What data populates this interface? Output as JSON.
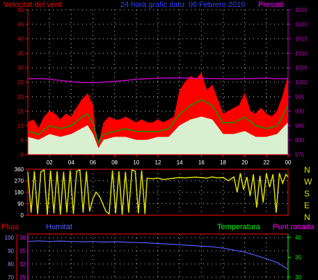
{
  "header": {
    "left": "Velocitat del vent",
    "center": "24 hora grafic datu: 06 Febrero 2019",
    "right": "Pressió"
  },
  "legend": {
    "rain": "Pluja",
    "humidity": "Humitat",
    "temperature": "Temperatura",
    "dewpoint": "Punt rosada"
  },
  "direction_labels": [
    "N",
    "W",
    "S",
    "E",
    "N"
  ],
  "colors": {
    "background": "#000000",
    "axis": "#ff0000",
    "grid": "#ffffff",
    "wind_gust": "#ff0000",
    "wind_avg": "#00a000",
    "wind_speed": "#d8f0d0",
    "pressure": "#c000c0",
    "direction": "#e0e000",
    "humidity": "#5060ff",
    "dewpoint_axis": "#ff00ff",
    "temperature_axis": "#00ff00",
    "rain_axis": "#ff0000"
  },
  "chart_data": [
    {
      "type": "area",
      "name": "wind_pressure",
      "title": "24 hora grafic datu: 06 Febrero 2019",
      "x_ticks": [
        "02",
        "04",
        "06",
        "08",
        "10",
        "12",
        "14",
        "16",
        "18",
        "20",
        "22",
        "00"
      ],
      "y_left_ticks": [
        "0",
        "5",
        "10",
        "15",
        "20",
        "25",
        "30",
        "35",
        "40",
        "45",
        "50"
      ],
      "y_left_label": "Velocitat del vent",
      "ylim_left": [
        0,
        50
      ],
      "y_right_ticks": [
        "975",
        "980",
        "985",
        "990",
        "995",
        "1000",
        "1005",
        "1010",
        "1015",
        "1020",
        "1025"
      ],
      "y_right_label": "Pressió",
      "ylim_right": [
        975,
        1025
      ],
      "x_range_hours": [
        0,
        24
      ],
      "series": [
        {
          "name": "gust",
          "role": "wind_gust",
          "points": [
            [
              0,
              11
            ],
            [
              0.5,
              12
            ],
            [
              1,
              9
            ],
            [
              1.5,
              13
            ],
            [
              2,
              15
            ],
            [
              2.5,
              14
            ],
            [
              3,
              12
            ],
            [
              3.5,
              14
            ],
            [
              4,
              13
            ],
            [
              4.5,
              16
            ],
            [
              5,
              19
            ],
            [
              5.5,
              21
            ],
            [
              6,
              17
            ],
            [
              6.2,
              8
            ],
            [
              6.5,
              3
            ],
            [
              7,
              11
            ],
            [
              7.5,
              13
            ],
            [
              8,
              12
            ],
            [
              8.5,
              12
            ],
            [
              9,
              13
            ],
            [
              9.5,
              12
            ],
            [
              10,
              11
            ],
            [
              10.5,
              12
            ],
            [
              11,
              11
            ],
            [
              11.5,
              11
            ],
            [
              12,
              12
            ],
            [
              12.5,
              11
            ],
            [
              13,
              12
            ],
            [
              13.5,
              13
            ],
            [
              14,
              22
            ],
            [
              14.5,
              25
            ],
            [
              15,
              27
            ],
            [
              15.5,
              26
            ],
            [
              16,
              28
            ],
            [
              16.5,
              22
            ],
            [
              17,
              24
            ],
            [
              17.5,
              19
            ],
            [
              18,
              14
            ],
            [
              18.5,
              15
            ],
            [
              19,
              16
            ],
            [
              19.5,
              17
            ],
            [
              20,
              21
            ],
            [
              20.5,
              15
            ],
            [
              21,
              14
            ],
            [
              21.5,
              16
            ],
            [
              22,
              14
            ],
            [
              22.5,
              13
            ],
            [
              23,
              15
            ],
            [
              23.5,
              20
            ],
            [
              24,
              27
            ]
          ]
        },
        {
          "name": "avg",
          "role": "wind_avg",
          "points": [
            [
              0,
              8
            ],
            [
              1,
              7
            ],
            [
              2,
              10
            ],
            [
              3,
              9
            ],
            [
              4,
              10
            ],
            [
              5,
              13
            ],
            [
              5.5,
              14
            ],
            [
              6,
              11
            ],
            [
              6.5,
              4
            ],
            [
              7,
              7
            ],
            [
              8,
              8
            ],
            [
              9,
              9
            ],
            [
              10,
              8
            ],
            [
              11,
              8
            ],
            [
              12,
              8
            ],
            [
              13,
              9
            ],
            [
              14,
              14
            ],
            [
              15,
              17
            ],
            [
              16,
              19
            ],
            [
              17,
              17
            ],
            [
              18,
              11
            ],
            [
              19,
              11
            ],
            [
              20,
              13
            ],
            [
              21,
              10
            ],
            [
              22,
              9
            ],
            [
              23,
              10
            ],
            [
              24,
              17
            ]
          ]
        },
        {
          "name": "speed",
          "role": "wind_speed",
          "points": [
            [
              0,
              6
            ],
            [
              1,
              5
            ],
            [
              2,
              7
            ],
            [
              3,
              6
            ],
            [
              4,
              7
            ],
            [
              5,
              9
            ],
            [
              5.5,
              10
            ],
            [
              6,
              7
            ],
            [
              6.5,
              2
            ],
            [
              7,
              5
            ],
            [
              8,
              6
            ],
            [
              9,
              6
            ],
            [
              10,
              5
            ],
            [
              11,
              5
            ],
            [
              12,
              6
            ],
            [
              13,
              6
            ],
            [
              14,
              10
            ],
            [
              15,
              12
            ],
            [
              16,
              13
            ],
            [
              17,
              12
            ],
            [
              18,
              7
            ],
            [
              19,
              7
            ],
            [
              20,
              8
            ],
            [
              21,
              6
            ],
            [
              22,
              6
            ],
            [
              23,
              7
            ],
            [
              24,
              11
            ]
          ]
        },
        {
          "name": "pressure",
          "role": "pressure",
          "points": [
            [
              0,
              1001.2
            ],
            [
              1,
              1001.3
            ],
            [
              2,
              1001
            ],
            [
              3,
              1000.6
            ],
            [
              4,
              1000.2
            ],
            [
              5,
              999.9
            ],
            [
              6,
              999.8
            ],
            [
              7,
              1000
            ],
            [
              8,
              1000.3
            ],
            [
              9,
              1000.6
            ],
            [
              10,
              1001
            ],
            [
              11,
              1001.2
            ],
            [
              12,
              1001.4
            ],
            [
              13,
              1001.5
            ],
            [
              14,
              1001.5
            ],
            [
              15,
              1001.4
            ],
            [
              16,
              1001.3
            ],
            [
              17,
              1001.3
            ],
            [
              18,
              1001.2
            ],
            [
              19,
              1001.1
            ],
            [
              20,
              1001.2
            ],
            [
              21,
              1001.3
            ],
            [
              22,
              1001.4
            ],
            [
              23,
              1001.2
            ],
            [
              24,
              1001.2
            ]
          ]
        }
      ]
    },
    {
      "type": "line",
      "name": "wind_direction",
      "y_ticks": [
        "0",
        "90",
        "180",
        "270",
        "360"
      ],
      "ylim": [
        0,
        360
      ],
      "x_range_hours": [
        0,
        24
      ],
      "series": [
        {
          "name": "direction",
          "role": "direction",
          "points": [
            [
              0,
              340
            ],
            [
              0.3,
              20
            ],
            [
              0.6,
              345
            ],
            [
              0.9,
              10
            ],
            [
              1.2,
              340
            ],
            [
              1.5,
              355
            ],
            [
              1.8,
              5
            ],
            [
              2.1,
              350
            ],
            [
              2.4,
              15
            ],
            [
              2.7,
              345
            ],
            [
              3,
              5
            ],
            [
              3.3,
              340
            ],
            [
              3.6,
              20
            ],
            [
              3.9,
              350
            ],
            [
              4.2,
              10
            ],
            [
              4.5,
              345
            ],
            [
              4.8,
              355
            ],
            [
              5.1,
              20
            ],
            [
              5.4,
              345
            ],
            [
              5.7,
              30
            ],
            [
              6,
              130
            ],
            [
              6.3,
              180
            ],
            [
              6.6,
              150
            ],
            [
              6.9,
              90
            ],
            [
              7.2,
              30
            ],
            [
              7.5,
              10
            ],
            [
              7.8,
              350
            ],
            [
              8.1,
              15
            ],
            [
              8.4,
              345
            ],
            [
              8.7,
              5
            ],
            [
              9,
              340
            ],
            [
              9.3,
              20
            ],
            [
              9.6,
              355
            ],
            [
              9.9,
              345
            ],
            [
              10.2,
              15
            ],
            [
              10.5,
              350
            ],
            [
              10.8,
              10
            ],
            [
              11,
              290
            ],
            [
              11.5,
              285
            ],
            [
              12,
              290
            ],
            [
              12.5,
              280
            ],
            [
              13,
              285
            ],
            [
              13.5,
              290
            ],
            [
              14,
              295
            ],
            [
              14.5,
              292
            ],
            [
              15,
              296
            ],
            [
              15.5,
              298
            ],
            [
              16,
              295
            ],
            [
              16.5,
              290
            ],
            [
              17,
              300
            ],
            [
              17.5,
              292
            ],
            [
              18,
              296
            ],
            [
              18.5,
              270
            ],
            [
              19,
              300
            ],
            [
              19.3,
              180
            ],
            [
              19.6,
              330
            ],
            [
              19.9,
              200
            ],
            [
              20.2,
              300
            ],
            [
              20.5,
              150
            ],
            [
              20.8,
              320
            ],
            [
              21.1,
              60
            ],
            [
              21.4,
              310
            ],
            [
              21.7,
              100
            ],
            [
              22,
              330
            ],
            [
              22.3,
              220
            ],
            [
              22.6,
              320
            ],
            [
              22.9,
              20
            ],
            [
              23.2,
              330
            ],
            [
              23.5,
              250
            ],
            [
              23.8,
              320
            ],
            [
              24,
              300
            ]
          ]
        }
      ]
    },
    {
      "type": "line",
      "name": "humidity_temperature",
      "y_left_ticks": [
        "70",
        "80",
        "90",
        "100"
      ],
      "ylim_left": [
        70,
        100
      ],
      "y_left2_ticks": [
        "29",
        "32",
        "35",
        "38"
      ],
      "ylim_left2": [
        29,
        38
      ],
      "y_right_ticks": [
        "30",
        "35",
        "40"
      ],
      "ylim_right": [
        30,
        40
      ],
      "x_range_hours": [
        0,
        24
      ],
      "series": [
        {
          "name": "humidity",
          "role": "humidity",
          "points": [
            [
              0,
              97
            ],
            [
              1,
              97.5
            ],
            [
              2,
              97
            ],
            [
              3,
              97.3
            ],
            [
              4,
              97
            ],
            [
              5,
              96.8
            ],
            [
              6,
              97
            ],
            [
              7,
              96.5
            ],
            [
              8,
              96.8
            ],
            [
              9,
              96.5
            ],
            [
              10,
              96.2
            ],
            [
              11,
              96
            ],
            [
              12,
              95.5
            ],
            [
              13,
              95
            ],
            [
              14,
              94.5
            ],
            [
              15,
              94
            ],
            [
              16,
              93.5
            ],
            [
              17,
              93
            ],
            [
              18,
              92
            ],
            [
              19,
              90.5
            ],
            [
              20,
              89
            ],
            [
              21,
              86.5
            ],
            [
              22,
              84
            ],
            [
              23,
              81
            ],
            [
              24,
              76
            ]
          ]
        }
      ]
    }
  ]
}
